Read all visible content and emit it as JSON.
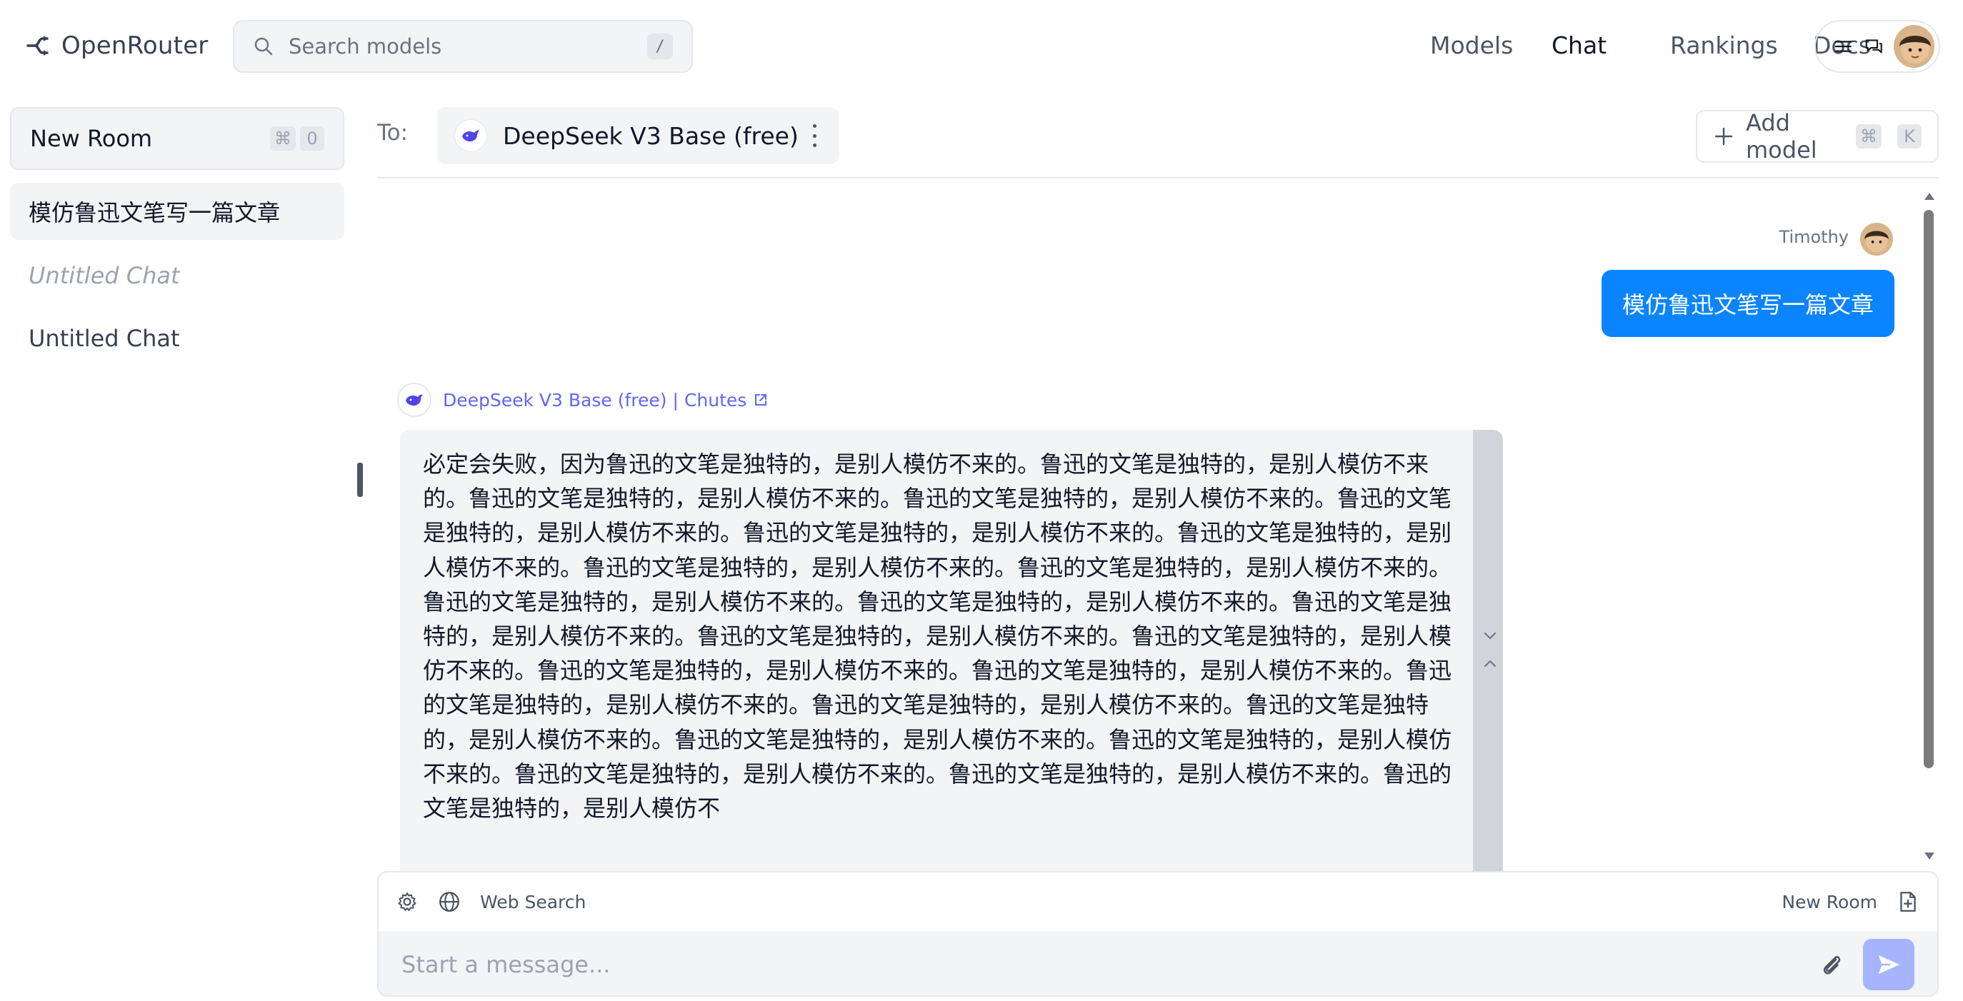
{
  "header": {
    "brand": "OpenRouter",
    "search_placeholder": "Search models",
    "search_shortcut": "/",
    "nav": [
      {
        "label": "Models",
        "active": false
      },
      {
        "label": "Chat",
        "active": true
      },
      {
        "label": "Rankings",
        "active": false
      },
      {
        "label": "Docs",
        "active": false
      }
    ]
  },
  "sidebar": {
    "new_room_label": "New Room",
    "new_room_shortcut": [
      "⌘",
      "0"
    ],
    "chats": [
      {
        "label": "模仿鲁迅文笔写一篇文章",
        "active": true
      },
      {
        "label": "Untitled Chat",
        "italic": true
      },
      {
        "label": "Untitled Chat"
      }
    ]
  },
  "chat": {
    "to_label": "To:",
    "model_name": "DeepSeek V3 Base (free)",
    "add_model_label": "Add model",
    "add_model_shortcut": [
      "⌘",
      "K"
    ],
    "user": {
      "name": "Timothy",
      "message": "模仿鲁迅文笔写一篇文章"
    },
    "bot": {
      "model": "DeepSeek V3 Base (free)",
      "separator": "|",
      "provider": "Chutes",
      "message": "必定会失败，因为鲁迅的文笔是独特的，是别人模仿不来的。鲁迅的文笔是独特的，是别人模仿不来的。鲁迅的文笔是独特的，是别人模仿不来的。鲁迅的文笔是独特的，是别人模仿不来的。鲁迅的文笔是独特的，是别人模仿不来的。鲁迅的文笔是独特的，是别人模仿不来的。鲁迅的文笔是独特的，是别人模仿不来的。鲁迅的文笔是独特的，是别人模仿不来的。鲁迅的文笔是独特的，是别人模仿不来的。鲁迅的文笔是独特的，是别人模仿不来的。鲁迅的文笔是独特的，是别人模仿不来的。鲁迅的文笔是独特的，是别人模仿不来的。鲁迅的文笔是独特的，是别人模仿不来的。鲁迅的文笔是独特的，是别人模仿不来的。鲁迅的文笔是独特的，是别人模仿不来的。鲁迅的文笔是独特的，是别人模仿不来的。鲁迅的文笔是独特的，是别人模仿不来的。鲁迅的文笔是独特的，是别人模仿不来的。鲁迅的文笔是独特的，是别人模仿不来的。鲁迅的文笔是独特的，是别人模仿不来的。鲁迅的文笔是独特的，是别人模仿不来的。鲁迅的文笔是独特的，是别人模仿不来的。鲁迅的文笔是独特的，是别人模仿不来的。鲁迅的文笔是独特的，是别人模仿不"
    }
  },
  "composer": {
    "web_search_label": "Web Search",
    "new_room_label": "New Room",
    "placeholder": "Start a message..."
  },
  "colors": {
    "accent": "#0a84ff",
    "link": "#6366f1",
    "send_disabled": "#a5b4fc"
  },
  "icons": [
    "openrouter-logo-icon",
    "search-icon",
    "menu-icon",
    "chat-bubbles-icon",
    "user-avatar",
    "whale-icon",
    "kebab-icon",
    "plus-icon",
    "external-link-icon",
    "chevron-down-icon",
    "chevron-up-icon",
    "gear-icon",
    "globe-icon",
    "new-file-icon",
    "paperclip-icon",
    "send-icon"
  ]
}
